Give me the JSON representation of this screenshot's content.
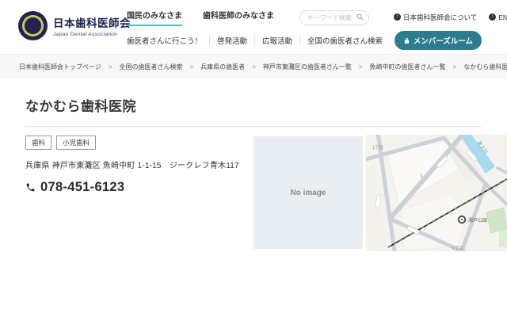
{
  "header": {
    "logo": {
      "title": "日本歯科医師会",
      "subtitle": "Japan Dental Association"
    },
    "tabs": [
      {
        "label": "国民のみなさま",
        "active": true
      },
      {
        "label": "歯科医師のみなさま",
        "active": false
      }
    ],
    "search": {
      "placeholder": "キーワード検索"
    },
    "utility_links": [
      {
        "icon": "›",
        "label": "日本歯科医師会について"
      },
      {
        "icon": "›",
        "label": "ENGLISH"
      }
    ],
    "nav_links": [
      "歯医者さんに行こう！",
      "啓発活動",
      "広報活動",
      "全国の歯医者さん検索"
    ],
    "members_button": "メンバーズルーム"
  },
  "breadcrumb": {
    "separator": ">",
    "items": [
      "日本歯科医師会トップページ",
      "全国の歯医者さん検索",
      "兵庫県の歯医者",
      "神戸市東灘区の歯医者さん一覧",
      "魚崎中町の歯医者さん一覧",
      "なかむら歯科医院"
    ]
  },
  "clinic": {
    "name": "なかむら歯科医院",
    "tags": [
      "歯科",
      "小児歯科"
    ],
    "address": "兵庫県 神戸市東灘区 魚崎中町 1-1-15　ジークレフ青木117",
    "phone": "078-451-6123"
  },
  "photo": {
    "placeholder": "No image"
  },
  "map": {
    "labels": {
      "district_top": "1丁目",
      "block": "1",
      "river": "天上川",
      "park": "瀬戸公園",
      "district_bottom": "6丁目"
    }
  },
  "colors": {
    "accent_teal": "#2c7c90",
    "tab_underline": "#49bdd8",
    "logo_navy": "#23234e",
    "breadcrumb_bg": "#f7f7f7",
    "no_image_bg": "#e9eef3",
    "river_blue": "#a8dcec"
  }
}
